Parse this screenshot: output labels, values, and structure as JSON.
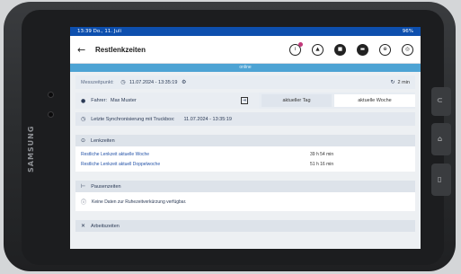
{
  "device": {
    "brand": "SAMSUNG"
  },
  "status_bar": {
    "time_date": "13:39 Do., 11. Juli",
    "indicators": "96%"
  },
  "appbar": {
    "title": "Restlenkzeiten",
    "icons": [
      "back-arrow-icon",
      "driver-card-icon",
      "warning-icon",
      "profile-icon",
      "truck-icon",
      "globe-icon",
      "tachograph-icon"
    ]
  },
  "connection": {
    "status": "online"
  },
  "measurement": {
    "label": "Messzeitpunkt:",
    "timestamp": "11.07.2024 - 13:35:19",
    "refresh_interval": "2 min"
  },
  "driver": {
    "label": "Fahrer:",
    "name": "Max Muster"
  },
  "tabs": {
    "day": "aktueller Tag",
    "week": "aktuelle Woche"
  },
  "sync": {
    "label": "Letzte Synchronisierung mit Truckbox:",
    "timestamp": "11.07.2024 - 13:35:19"
  },
  "sections": {
    "driving": {
      "title": "Lenkzeiten",
      "rows": [
        {
          "label": "Restliche Lenkzeit aktuelle Woche",
          "value": "39 h  54 min"
        },
        {
          "label": "Restliche Lenkzeit aktuell Doppelwoche",
          "value": "51 h  16 min"
        }
      ]
    },
    "breaks": {
      "title": "Pausenzeiten",
      "note": "Keine Daten zur Ruhezeitverkürzung verfügbar."
    },
    "work": {
      "title": "Arbeitszeiten"
    }
  },
  "colors": {
    "statusbar": "#0d4fae",
    "online": "#4da3d4",
    "link": "#2453a8",
    "badge": "#c2387b"
  }
}
